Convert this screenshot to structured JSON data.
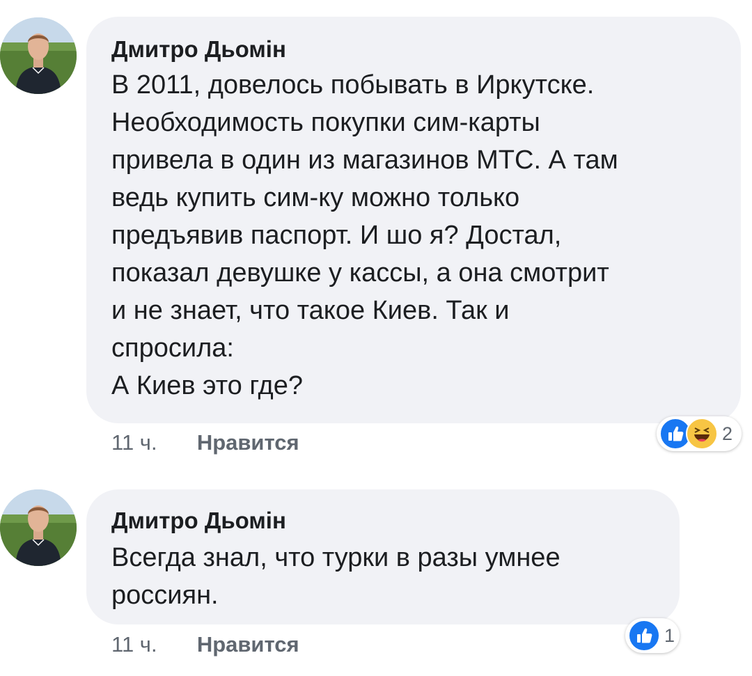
{
  "colors": {
    "bubble": "#f1f2f6",
    "like_blue": "#1877f2",
    "haha_yellow": "#f7c544",
    "meta_gray": "#606770"
  },
  "comments": [
    {
      "author": "Дмитро Дьомін",
      "lines": [
        "В 2011, довелось побывать в Иркутске.",
        "Необходимость покупки сим-карты",
        "привела в один из магазинов МТС. А там",
        "ведь купить сим-ку можно только",
        "предъявив паспорт. И шо я? Достал,",
        "показал девушке у кассы, а она смотрит",
        "и не знает, что такое Киев. Так и",
        "спросила:",
        "А Киев это где?"
      ],
      "time": "11 ч.",
      "like_label": "Нравится",
      "reactions": [
        "like-icon",
        "haha-icon"
      ],
      "reaction_count": "2"
    },
    {
      "author": "Дмитро Дьомін",
      "lines": [
        "Всегда знал, что турки в разы умнее",
        "россиян."
      ],
      "time": "11 ч.",
      "like_label": "Нравится",
      "reactions": [
        "like-icon"
      ],
      "reaction_count": "1"
    }
  ]
}
